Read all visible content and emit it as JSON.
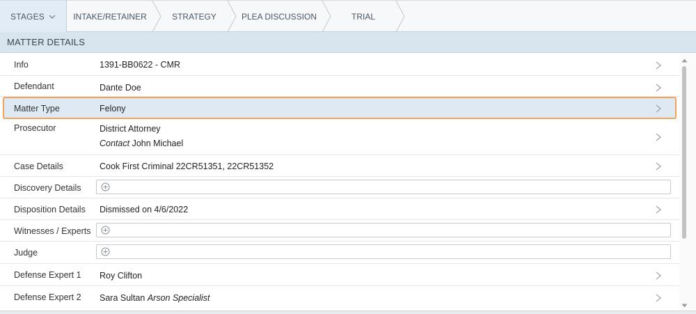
{
  "stages_bar": {
    "stages_button": "STAGES",
    "stages": [
      "INTAKE/RETAINER",
      "STRATEGY",
      "PLEA DISCUSSION",
      "TRIAL"
    ]
  },
  "matter_details": {
    "title": "MATTER DETAILS",
    "rows": [
      {
        "label": "Info",
        "value": "1391-BB0622 - CMR"
      },
      {
        "label": "Defendant",
        "value": "Dante Doe"
      },
      {
        "label": "Matter Type",
        "value": "Felony"
      },
      {
        "label": "Prosecutor",
        "value": "District Attorney",
        "contact_label": "Contact",
        "contact_value": "John Michael"
      },
      {
        "label": "Case Details",
        "value": "Cook First Criminal 22CR51351, 22CR51352"
      },
      {
        "label": "Discovery Details",
        "value": ""
      },
      {
        "label": "Disposition Details",
        "value": "Dismissed on 4/6/2022"
      },
      {
        "label": "Witnesses / Experts",
        "value": ""
      },
      {
        "label": "Judge",
        "value": ""
      },
      {
        "label": "Defense Expert 1",
        "value": "Roy Clifton"
      },
      {
        "label": "Defense Expert 2",
        "value": "Sara Sultan",
        "note": "Arson Specialist"
      }
    ]
  },
  "colors": {
    "selected_outline": "#f0a35a",
    "selected_bg": "#dfe9f3",
    "header_bg": "#d8e4ee"
  }
}
